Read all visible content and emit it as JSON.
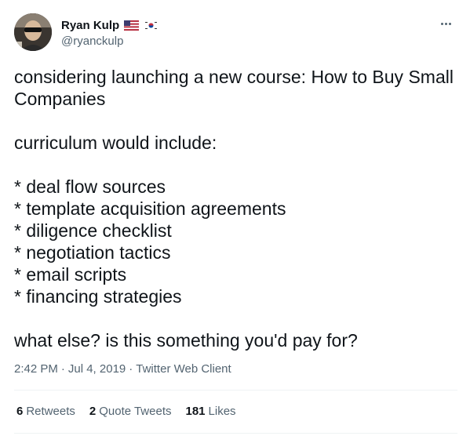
{
  "author": {
    "name": "Ryan Kulp",
    "handle": "@ryanckulp"
  },
  "tweet": {
    "lines": [
      "considering launching a new course: How to Buy Small Companies",
      "",
      "curriculum would include:",
      "",
      "* deal flow sources",
      "* template acquisition agreements",
      "* diligence checklist",
      "* negotiation tactics",
      "* email scripts",
      "* financing strategies",
      "",
      "what else? is this something you'd pay for?"
    ],
    "time": "2:42 PM",
    "separator": "·",
    "date": "Jul 4, 2019",
    "client": "Twitter Web Client"
  },
  "stats": {
    "retweets_count": "6",
    "retweets_label": "Retweets",
    "quotes_count": "2",
    "quotes_label": "Quote Tweets",
    "likes_count": "181",
    "likes_label": "Likes"
  },
  "icons": {
    "avatar": "profile-photo",
    "flag1": "us-flag-icon",
    "flag2": "south-korea-flag-icon",
    "more": "more-options-icon"
  },
  "colors": {
    "text": "#0f1419",
    "secondary": "#536471",
    "divider": "#eff3f4"
  }
}
